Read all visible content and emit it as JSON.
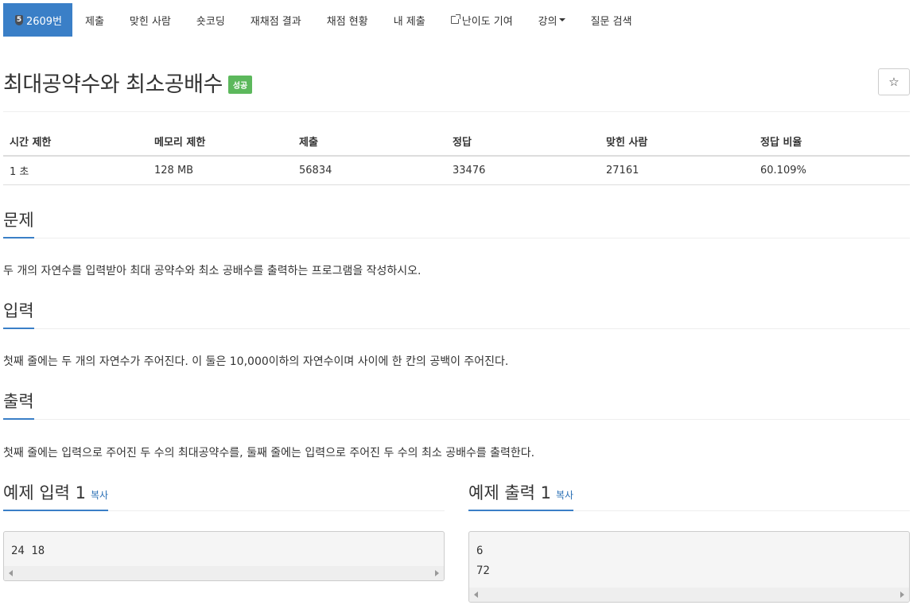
{
  "nav": {
    "problem_number": "2609번",
    "tier_badge": "5",
    "items": [
      "제출",
      "맞힌 사람",
      "숏코딩",
      "재채점 결과",
      "채점 현황",
      "내 제출",
      "난이도 기여",
      "강의",
      "질문 검색"
    ]
  },
  "problem": {
    "title": "최대공약수와 최소공배수",
    "status": "성공",
    "star": "☆"
  },
  "info_table": {
    "headers": [
      "시간 제한",
      "메모리 제한",
      "제출",
      "정답",
      "맞힌 사람",
      "정답 비율"
    ],
    "values": [
      "1 초",
      "128 MB",
      "56834",
      "33476",
      "27161",
      "60.109%"
    ]
  },
  "sections": {
    "description": {
      "title": "문제",
      "text": "두 개의 자연수를 입력받아 최대 공약수와 최소 공배수를 출력하는 프로그램을 작성하시오."
    },
    "input": {
      "title": "입력",
      "text": "첫째 줄에는 두 개의 자연수가 주어진다. 이 둘은 10,000이하의 자연수이며 사이에 한 칸의 공백이 주어진다."
    },
    "output": {
      "title": "출력",
      "text": "첫째 줄에는 입력으로 주어진 두 수의 최대공약수를, 둘째 줄에는 입력으로 주어진 두 수의 최소 공배수를 출력한다."
    }
  },
  "examples": {
    "input_title": "예제 입력 1",
    "output_title": "예제 출력 1",
    "copy_label": "복사",
    "input_lines": [
      "24 18"
    ],
    "output_lines": [
      "6",
      "72"
    ]
  },
  "colors": {
    "accent": "#3a7fc7",
    "success": "#5cb85c"
  }
}
